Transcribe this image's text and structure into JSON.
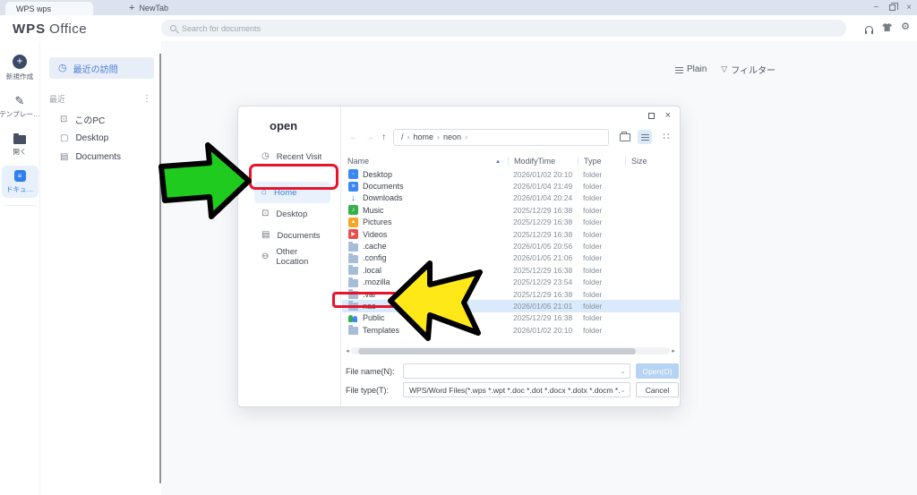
{
  "window": {
    "tab_title": "WPS wps",
    "new_tab_label": "NewTab",
    "new_tab_plus": "+",
    "minimize": "−",
    "close": "×"
  },
  "appbar": {
    "logo_wps": "WPS",
    "logo_office": "Office",
    "search_placeholder": "Search for documents"
  },
  "rail": {
    "items": [
      {
        "label": "新規作成",
        "icon": "plus-circle",
        "active": false
      },
      {
        "label": "テンプレー…",
        "icon": "template-pen",
        "active": false
      },
      {
        "label": "開く",
        "icon": "folder",
        "active": false
      },
      {
        "label": "ドキュ…",
        "icon": "document",
        "active": true
      }
    ]
  },
  "panel": {
    "selected_item": "最近の訪問",
    "section_label": "最近",
    "kebab": "⋮",
    "items": [
      {
        "label": "このPC",
        "icon": "pc"
      },
      {
        "label": "Desktop",
        "icon": "desktop"
      },
      {
        "label": "Documents",
        "icon": "documents"
      }
    ]
  },
  "main_toolbar": {
    "plain_label": "Plain",
    "filter_label": "フィルター"
  },
  "dialog": {
    "title": "open",
    "sidebar": [
      {
        "label": "Recent Visit",
        "icon": "◷",
        "selected": false
      },
      {
        "label": "Home",
        "icon": "⌂",
        "selected": true
      },
      {
        "label": "Desktop",
        "icon": "⊡",
        "selected": false
      },
      {
        "label": "Documents",
        "icon": "▤",
        "selected": false
      },
      {
        "label": "Other Location",
        "icon": "⊖",
        "selected": false
      }
    ],
    "nav": {
      "back": "←",
      "forward": "→",
      "up": "↑"
    },
    "breadcrumb": [
      "/",
      "home",
      "neon"
    ],
    "breadcrumb_sep": "›",
    "columns": [
      "Name",
      "ModifyTime",
      "Type",
      "Size"
    ],
    "sort_indicator": "▲",
    "files": [
      {
        "name": "Desktop",
        "icon": "desktop",
        "glyph": "▫",
        "modified": "2026/01/02 20:10",
        "type": "folder",
        "selected": false
      },
      {
        "name": "Documents",
        "icon": "documents",
        "glyph": "≡",
        "modified": "2026/01/04 21:49",
        "type": "folder",
        "selected": false
      },
      {
        "name": "Downloads",
        "icon": "downloads",
        "glyph": "↓",
        "modified": "2026/01/04 20:24",
        "type": "folder",
        "selected": false
      },
      {
        "name": "Music",
        "icon": "music",
        "glyph": "♪",
        "modified": "2025/12/29 16:38",
        "type": "folder",
        "selected": false
      },
      {
        "name": "Pictures",
        "icon": "pictures",
        "glyph": "▲",
        "modified": "2025/12/29 16:38",
        "type": "folder",
        "selected": false
      },
      {
        "name": "Videos",
        "icon": "videos",
        "glyph": "▶",
        "modified": "2025/12/29 16:38",
        "type": "folder",
        "selected": false
      },
      {
        "name": ".cache",
        "icon": "folder",
        "glyph": "",
        "modified": "2026/01/05 20:56",
        "type": "folder",
        "selected": false
      },
      {
        "name": ".config",
        "icon": "folder",
        "glyph": "",
        "modified": "2026/01/05 21:06",
        "type": "folder",
        "selected": false
      },
      {
        "name": ".local",
        "icon": "folder",
        "glyph": "",
        "modified": "2025/12/29 16:38",
        "type": "folder",
        "selected": false
      },
      {
        "name": ".mozilla",
        "icon": "folder",
        "glyph": "",
        "modified": "2025/12/29 23:54",
        "type": "folder",
        "selected": false
      },
      {
        "name": ".var",
        "icon": "folder",
        "glyph": "",
        "modified": "2025/12/29 16:38",
        "type": "folder",
        "selected": false
      },
      {
        "name": "nas",
        "icon": "folder",
        "glyph": "",
        "modified": "2026/01/05 21:01",
        "type": "folder",
        "selected": true
      },
      {
        "name": "Public",
        "icon": "public",
        "glyph": "",
        "modified": "2025/12/29 16:38",
        "type": "folder",
        "selected": false
      },
      {
        "name": "Templates",
        "icon": "folder",
        "glyph": "",
        "modified": "2026/01/02 20:10",
        "type": "folder",
        "selected": false
      }
    ],
    "file_name_label": "File name(N):",
    "file_name_value": "",
    "file_type_label": "File type(T):",
    "file_type_value": "WPS/Word Files(*.wps *.wpt *.doc *.dot *.docx *.dotx *.docm *.dotm)",
    "open_button": "Open(O)",
    "cancel_button": "Cancel",
    "maximize": "",
    "close": "×"
  },
  "colors": {
    "accent_blue": "#2f7ef0",
    "selection_blue": "#d8eafc",
    "annotation_red": "#e9132a",
    "annotation_green": "#1ecb1e",
    "annotation_yellow": "#ffe817"
  }
}
